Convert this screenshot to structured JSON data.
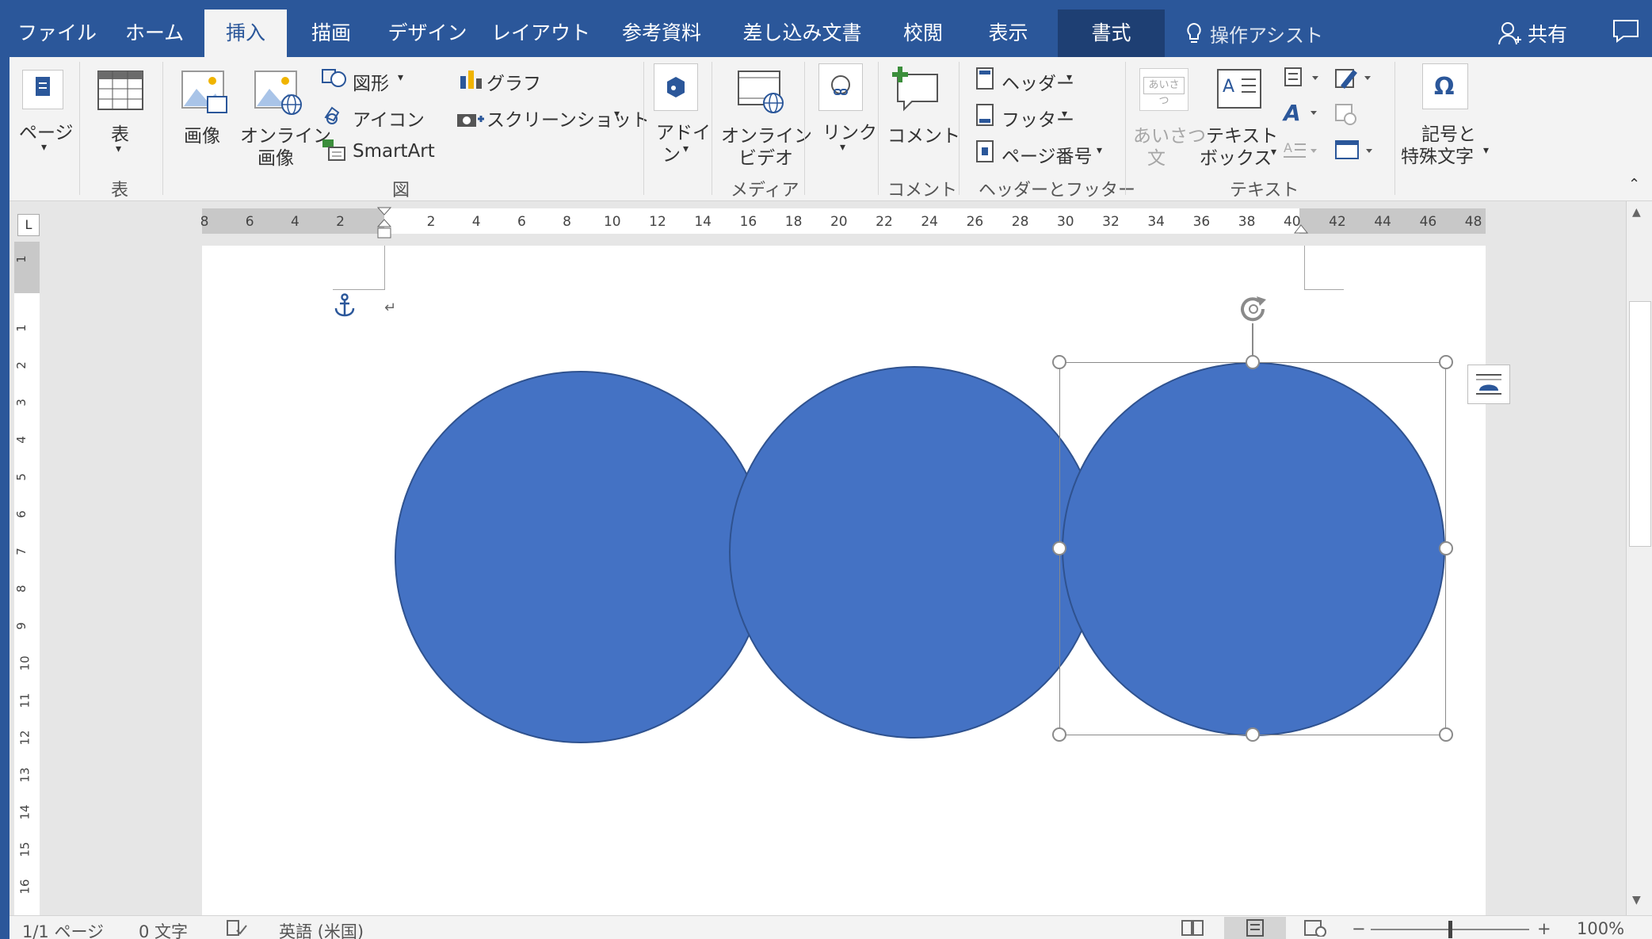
{
  "tabs": [
    "ファイル",
    "ホーム",
    "挿入",
    "描画",
    "デザイン",
    "レイアウト",
    "参考資料",
    "差し込み文書",
    "校閲",
    "表示",
    "書式"
  ],
  "active_tab": "挿入",
  "tell_me": "操作アシスト",
  "share": "共有",
  "ribbon": {
    "page": "ページ",
    "table": "表",
    "group_table": "表",
    "image": "画像",
    "online_image_1": "オンライン",
    "online_image_2": "画像",
    "shapes": "図形",
    "icons": "アイコン",
    "smartart": "SmartArt",
    "chart": "グラフ",
    "screenshot": "スクリーンショット",
    "group_illustrations": "図",
    "addins_1": "アドイ",
    "addins_2": "ン",
    "online_video_1": "オンライン",
    "online_video_2": "ビデオ",
    "group_media": "メディア",
    "link": "リンク",
    "comment": "コメント",
    "group_comment": "コメント",
    "header": "ヘッダー",
    "footer": "フッター",
    "page_number": "ページ番号",
    "group_header_footer": "ヘッダーとフッター",
    "greeting_1": "あいさつ",
    "greeting_2": "文",
    "greeting_icon_text": "あいさつ",
    "textbox_1": "テキスト",
    "textbox_2": "ボックス",
    "group_text": "テキスト",
    "symbols_1": "記号と",
    "symbols_2": "特殊文字"
  },
  "ruler_ticks": [
    "8",
    "6",
    "4",
    "2",
    "2",
    "4",
    "6",
    "8",
    "10",
    "12",
    "14",
    "16",
    "18",
    "20",
    "22",
    "24",
    "26",
    "28",
    "30",
    "32",
    "34",
    "36",
    "38",
    "40",
    "42",
    "44",
    "46",
    "48"
  ],
  "vruler_ticks": [
    "1",
    "1",
    "2",
    "3",
    "4",
    "5",
    "6",
    "7",
    "8",
    "9",
    "10",
    "11",
    "12",
    "13",
    "14",
    "15",
    "16"
  ],
  "status": {
    "pages": "1/1 ページ",
    "words": "0 文字",
    "language": "英語 (米国)",
    "zoom": "100%"
  },
  "colors": {
    "accent": "#2b579a",
    "shape_fill": "#4472c4",
    "shape_border": "#2f528f"
  }
}
